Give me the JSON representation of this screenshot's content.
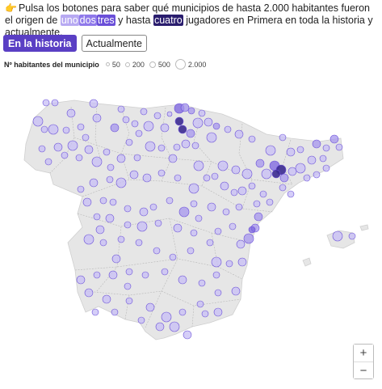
{
  "intro": {
    "hand_icon": "pointing-hand",
    "text1": "Pulsa los botones para saber qué municipios de hasta 2.000 habitantes fueron el origen de",
    "chip_uno": "uno",
    "chip_dos": "dos",
    "chip_tres": "tres",
    "text2": "y hasta",
    "chip_cuatro": "cuatro",
    "text3": "jugadores en Primera en toda la historia y actualmente."
  },
  "buttons": {
    "historia": "En la historia",
    "actualmente": "Actualmente",
    "selected": "En la historia"
  },
  "legend": {
    "title": "Nº habitantes del municipio",
    "items": [
      {
        "label": "50"
      },
      {
        "label": "200"
      },
      {
        "label": "500"
      },
      {
        "label": "2.000"
      }
    ]
  },
  "colors": {
    "uno": "#b7a9f2",
    "dos": "#8f79ea",
    "tres": "#6a4fd8",
    "cuatro": "#2a1d6e",
    "land": "#e6e6e6",
    "border": "#b2b2b2"
  },
  "zoom": {
    "in": "+",
    "out": "−"
  }
}
